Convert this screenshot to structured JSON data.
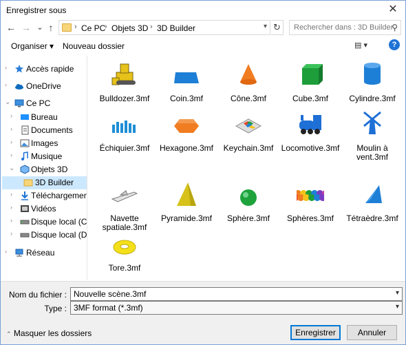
{
  "window": {
    "title": "Enregistrer sous",
    "close_glyph": "✕"
  },
  "nav": {
    "back": "←",
    "forward": "→",
    "dropdown": "⌄",
    "up": "↑",
    "breadcrumbs": [
      "Ce PC",
      "Objets 3D",
      "3D Builder"
    ],
    "refresh": "↻",
    "search_placeholder": "Rechercher dans : 3D Builder"
  },
  "toolbar": {
    "organize": "Organiser ▾",
    "new_folder": "Nouveau dossier",
    "view": "▤ ▾",
    "help": "?"
  },
  "sidebar": {
    "items": [
      {
        "label": "Accès rapide",
        "icon": "star-icon"
      },
      {
        "label": "OneDrive",
        "icon": "cloud-icon"
      },
      {
        "label": "Ce PC",
        "icon": "computer-icon"
      },
      {
        "label": "Bureau",
        "icon": "desktop-icon"
      },
      {
        "label": "Documents",
        "icon": "documents-icon"
      },
      {
        "label": "Images",
        "icon": "images-icon"
      },
      {
        "label": "Musique",
        "icon": "music-icon"
      },
      {
        "label": "Objets 3D",
        "icon": "cube-icon"
      },
      {
        "label": "3D Builder",
        "icon": "folder-icon"
      },
      {
        "label": "Téléchargements",
        "icon": "download-icon"
      },
      {
        "label": "Vidéos",
        "icon": "video-icon"
      },
      {
        "label": "Disque local (C:)",
        "icon": "drive-icon"
      },
      {
        "label": "Disque local (D:)",
        "icon": "drive-icon"
      },
      {
        "label": "Réseau",
        "icon": "network-icon"
      }
    ]
  },
  "files": [
    {
      "name": "Bulldozer.3mf",
      "icon": "bulldozer-icon"
    },
    {
      "name": "Coin.3mf",
      "icon": "wedge-icon"
    },
    {
      "name": "Cône.3mf",
      "icon": "cone-icon"
    },
    {
      "name": "Cube.3mf",
      "icon": "cube-icon"
    },
    {
      "name": "Cylindre.3mf",
      "icon": "cylinder-icon"
    },
    {
      "name": "Échiquier.3mf",
      "icon": "chess-icon"
    },
    {
      "name": "Hexagone.3mf",
      "icon": "hexagon-icon"
    },
    {
      "name": "Keychain.3mf",
      "icon": "keychain-icon"
    },
    {
      "name": "Locomotive.3mf",
      "icon": "locomotive-icon"
    },
    {
      "name": "Moulin à vent.3mf",
      "icon": "windmill-icon"
    },
    {
      "name": "Navette spatiale.3mf",
      "icon": "shuttle-icon"
    },
    {
      "name": "Pyramide.3mf",
      "icon": "pyramid-icon"
    },
    {
      "name": "Sphère.3mf",
      "icon": "sphere-icon"
    },
    {
      "name": "Sphères.3mf",
      "icon": "spheres-icon"
    },
    {
      "name": "Tétraèdre.3mf",
      "icon": "tetrahedron-icon"
    },
    {
      "name": "Tore.3mf",
      "icon": "torus-icon"
    }
  ],
  "form": {
    "filename_label": "Nom du fichier :",
    "filename_value": "Nouvelle scène.3mf",
    "type_label": "Type :",
    "type_value": "3MF format (*.3mf)"
  },
  "footer": {
    "hide_folders": "Masquer les dossiers",
    "save": "Enregistrer",
    "cancel": "Annuler"
  },
  "colors": {
    "accent": "#0078d7",
    "selection": "#cce8ff"
  }
}
